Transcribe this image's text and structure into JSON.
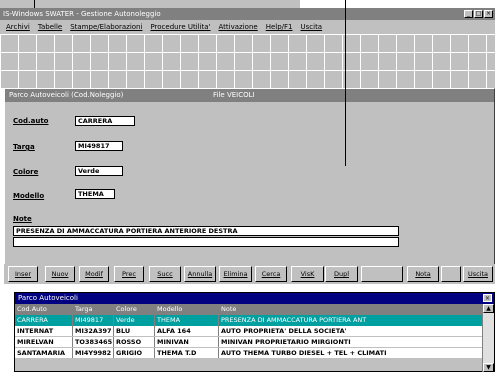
{
  "window": {
    "title": "IS-Windows SWATER - Gestione Autonoleggio",
    "controls": [
      "_",
      "□",
      "×"
    ]
  },
  "menu": [
    "Archivi",
    "Tabelle",
    "Stampe/Elaborazioni",
    "Procedure Utilita'",
    "Attivazione",
    "Help/F1",
    "Uscita"
  ],
  "form": {
    "title": "Parco Autoveicoli (Cod.Noleggio)",
    "file_label": "File VEICOLI",
    "fields": {
      "cod_auto": {
        "label": "Cod.auto",
        "value": "CARRERA"
      },
      "targa": {
        "label": "Targa",
        "value": "MI49817"
      },
      "colore": {
        "label": "Colore",
        "value": "Verde"
      },
      "modello": {
        "label": "Modello",
        "value": "THEMA"
      },
      "note": {
        "label": "Note",
        "value": "PRESENZA DI AMMACCATURA PORTIERA ANTERIORE DESTRA",
        "value2": ""
      }
    }
  },
  "buttons": {
    "inser": "Inser",
    "nuov": "Nuov",
    "modif": "Modif",
    "prec": "Prec",
    "succ": "Succ",
    "annulla": "Annulla",
    "elimina": "Elimina",
    "cerca": "Cerca",
    "visk": "VisK",
    "dupl": "Dupl",
    "blank": "",
    "nota": "Nota",
    "blank2": "",
    "uscita": "Uscita"
  },
  "grid": {
    "title": "Parco Autoveicoli",
    "close": "×",
    "columns": [
      "Cod.Auto",
      "Targa",
      "Colore",
      "Modello",
      "Note"
    ],
    "rows": [
      [
        "CARRERA",
        "MI49817",
        "Verde",
        "THEMA",
        "PRESENZA DI AMMACCATURA PORTIERA ANT"
      ],
      [
        "INTERNAT",
        "MI32A397",
        "BLU",
        "ALFA 164",
        "AUTO PROPRIETA' DELLA SOCIETA'"
      ],
      [
        "MIRELVAN",
        "TO383465",
        "ROSSO",
        "MINIVAN",
        "MINIVAN PROPRIETARIO MIRGIONTI"
      ],
      [
        "SANTAMARIA",
        "MI4Y9982",
        "GRIGIO",
        "THEMA T.D",
        "AUTO THEMA TURBO DIESEL + TEL + CLIMATI"
      ]
    ],
    "scroll_up": "▲",
    "scroll_down": "▼"
  }
}
